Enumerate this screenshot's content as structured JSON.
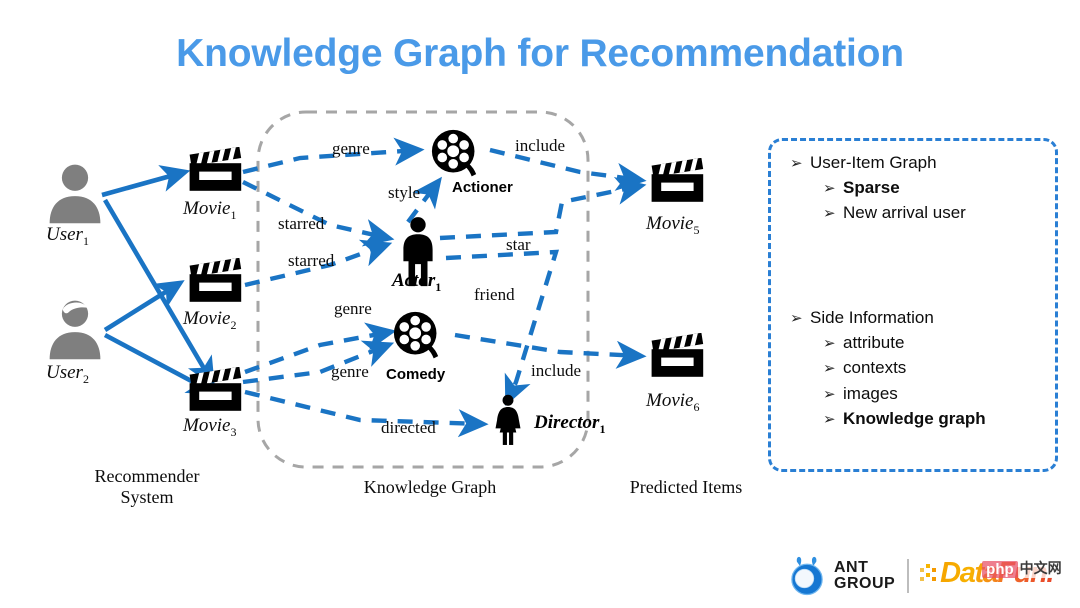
{
  "title": "Knowledge Graph for Recommendation",
  "colors": {
    "title_blue": "#4a9ae8",
    "arrow_blue": "#1a74c4",
    "dashed_blue": "#2a7fd4",
    "boundary_gray": "#a6a6a6",
    "user_gray": "#7f7f7f",
    "icon_black": "#000000"
  },
  "left_column": {
    "caption_line1": "Recommender",
    "caption_line2": "System",
    "users": [
      {
        "label": "User",
        "sub": "1",
        "icon": "user-avatar-icon"
      },
      {
        "label": "User",
        "sub": "2",
        "icon": "user-avatar-hat-icon"
      }
    ],
    "movies": [
      {
        "label": "Movie",
        "sub": "1",
        "icon": "clapperboard-icon"
      },
      {
        "label": "Movie",
        "sub": "2",
        "icon": "clapperboard-icon"
      },
      {
        "label": "Movie",
        "sub": "3",
        "icon": "clapperboard-icon"
      }
    ]
  },
  "center": {
    "caption": "Knowledge Graph",
    "entities": [
      {
        "name": "Actioner",
        "icon": "film-reel-icon",
        "style": "bold"
      },
      {
        "name": "Actor",
        "sub": "1",
        "icon": "person-male-icon",
        "style": "bold-italic"
      },
      {
        "name": "Comedy",
        "icon": "film-reel-icon",
        "style": "bold"
      },
      {
        "name": "Director",
        "sub": "1",
        "icon": "person-female-icon",
        "style": "bold-italic"
      }
    ],
    "edge_labels": [
      "genre",
      "include",
      "style",
      "starred",
      "star",
      "starred",
      "friend",
      "genre",
      "genre",
      "include",
      "directed"
    ]
  },
  "right_column": {
    "caption": "Predicted Items",
    "movies": [
      {
        "label": "Movie",
        "sub": "5",
        "icon": "clapperboard-icon"
      },
      {
        "label": "Movie",
        "sub": "6",
        "icon": "clapperboard-icon"
      }
    ]
  },
  "panel": {
    "bullet_glyph": "➢",
    "groups": [
      {
        "heading": "User-Item Graph",
        "items": [
          {
            "text": "Sparse",
            "bold": true
          },
          {
            "text": "New arrival user",
            "bold": false
          }
        ]
      },
      {
        "heading": "Side Information",
        "items": [
          {
            "text": "attribute",
            "bold": false
          },
          {
            "text": "contexts",
            "bold": false
          },
          {
            "text": "images",
            "bold": false
          },
          {
            "text": "Knowledge graph",
            "bold": true
          }
        ]
      }
    ]
  },
  "footer": {
    "ant_line1": "ANT",
    "ant_line2": "GROUP",
    "datafun": "DataFun.",
    "watermark_php": "php",
    "watermark_cn": "中文网"
  }
}
